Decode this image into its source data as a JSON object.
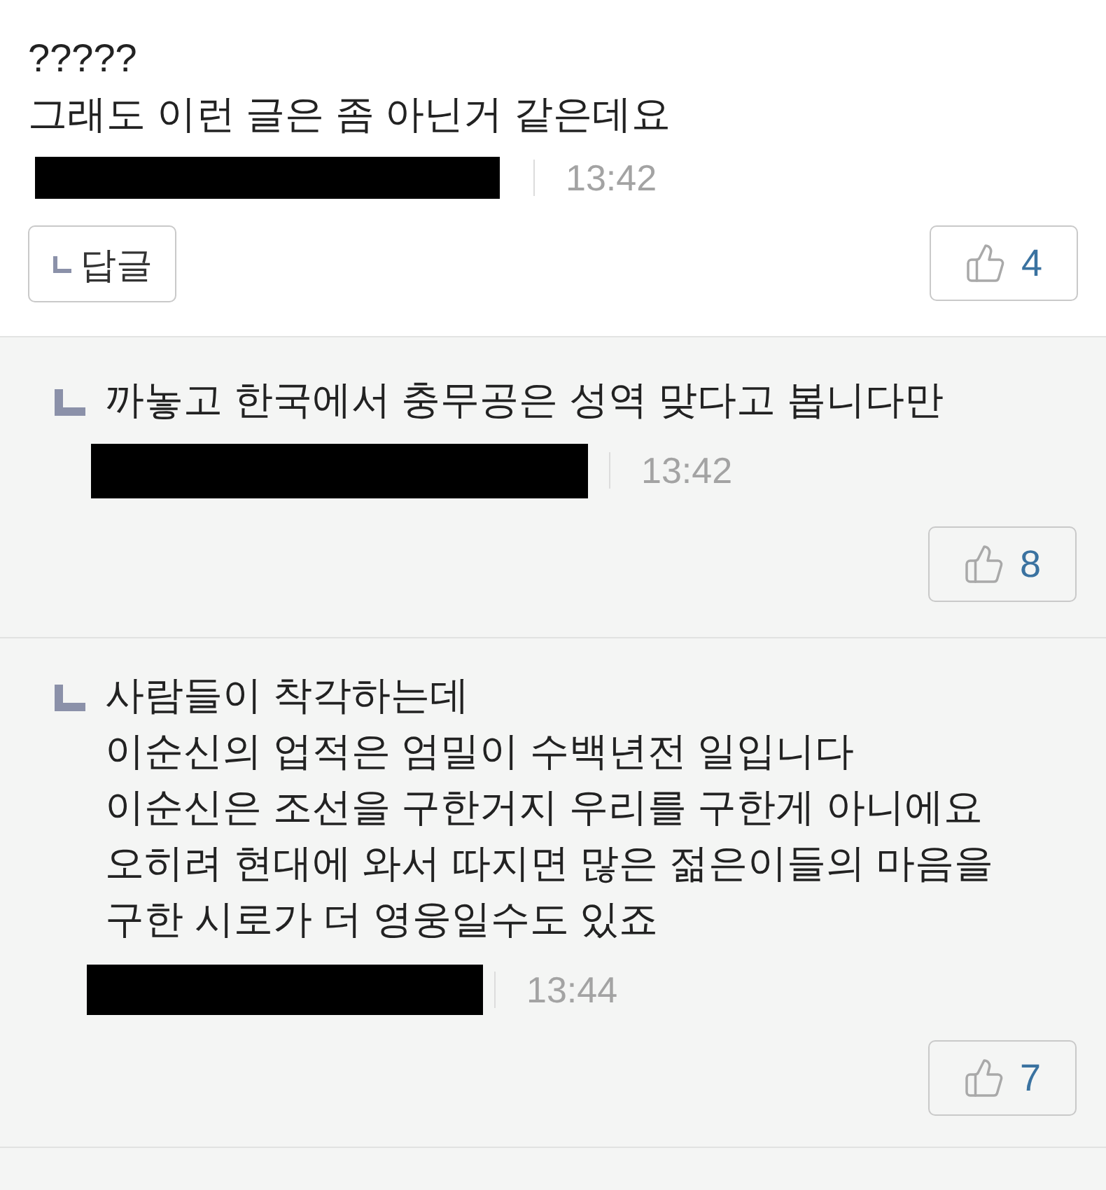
{
  "comment": {
    "text": "?????\n그래도 이런 글은 좀 아닌거 같은데요",
    "author": {
      "redacted": true
    },
    "time": "13:42",
    "reply_button": {
      "label": "답글"
    },
    "like_button": {
      "count": "4"
    }
  },
  "replies": [
    {
      "text": "까놓고 한국에서 충무공은 성역 맞다고 봅니다만",
      "author": {
        "redacted": true
      },
      "time": "13:42",
      "like_button": {
        "count": "8"
      }
    },
    {
      "text": "사람들이 착각하는데\n이순신의 업적은 엄밀이 수백년전 일입니다\n이순신은 조선을 구한거지 우리를 구한게 아니에요\n오히려 현대에 와서 따지면 많은 젊은이들의 마음을\n구한 시로가 더 영웅일수도 있죠",
      "author": {
        "redacted": true
      },
      "time": "13:44",
      "like_button": {
        "count": "7"
      }
    }
  ]
}
